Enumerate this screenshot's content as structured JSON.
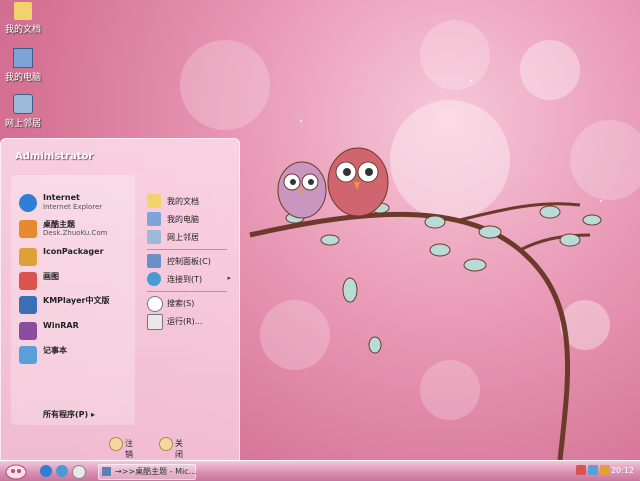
{
  "desktop": {
    "icons": [
      {
        "label": "我的文档"
      },
      {
        "label": "我的电脑"
      },
      {
        "label": "网上邻居"
      }
    ]
  },
  "start_menu": {
    "user": "Administrator",
    "left_items": [
      {
        "title": "Internet",
        "subtitle": "Internet Explorer"
      },
      {
        "title": "桌酷主题",
        "subtitle": "Desk.ZhuoKu.Com"
      },
      {
        "title": "IconPackager",
        "subtitle": ""
      },
      {
        "title": "画图",
        "subtitle": ""
      },
      {
        "title": "KMPlayer中文版",
        "subtitle": ""
      },
      {
        "title": "WinRAR",
        "subtitle": ""
      },
      {
        "title": "记事本",
        "subtitle": ""
      }
    ],
    "all_programs": "所有程序(P) ▸",
    "right_items": [
      {
        "label": "我的文档"
      },
      {
        "label": "我的电脑"
      },
      {
        "label": "网上邻居"
      },
      {
        "label": "控制面板(C)"
      },
      {
        "label": "连接到(T)",
        "arrow": "▸"
      },
      {
        "label": "搜索(S)"
      },
      {
        "label": "运行(R)..."
      }
    ],
    "footer": {
      "logoff": "注销(L)",
      "shutdown": "关闭计算机(U)"
    }
  },
  "taskbar": {
    "task_label": "→>>桌酷主题 - Mic...",
    "clock": "20:12"
  }
}
